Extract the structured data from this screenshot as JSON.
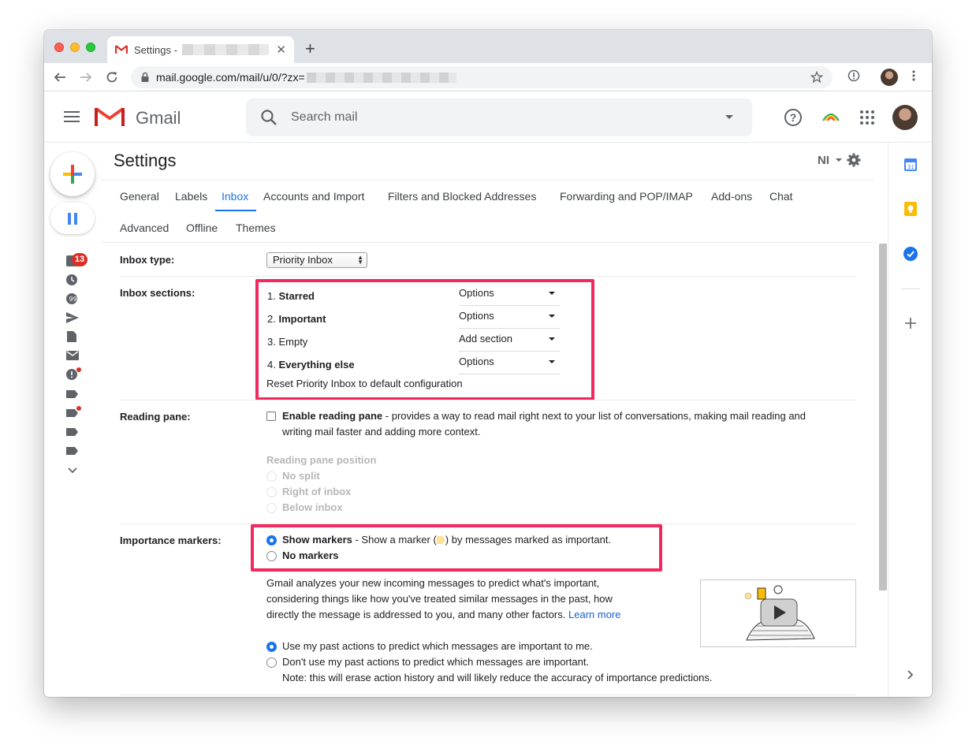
{
  "browser": {
    "tab_title": "Settings -",
    "tab_close": "✕",
    "new_tab": "+",
    "url": "mail.google.com/mail/u/0/?zx="
  },
  "header": {
    "app_name": "Gmail",
    "search_placeholder": "Search mail",
    "account_initials": "NI"
  },
  "left_rail": {
    "inbox_badge": "13"
  },
  "settings": {
    "title": "Settings",
    "tabs": [
      "General",
      "Labels",
      "Inbox",
      "Accounts and Import",
      "Filters and Blocked Addresses",
      "Forwarding and POP/IMAP",
      "Add-ons",
      "Chat",
      "Advanced",
      "Offline",
      "Themes"
    ],
    "active_tab": "Inbox",
    "inbox_type": {
      "label": "Inbox type:",
      "value": "Priority Inbox"
    },
    "inbox_sections": {
      "label": "Inbox sections:",
      "sections": [
        {
          "num": "1.",
          "name": "Starred",
          "bold": true,
          "action": "Options"
        },
        {
          "num": "2.",
          "name": "Important",
          "bold": true,
          "action": "Options"
        },
        {
          "num": "3.",
          "name": "Empty",
          "bold": false,
          "action": "Add section"
        },
        {
          "num": "4.",
          "name": "Everything else",
          "bold": true,
          "action": "Options"
        }
      ],
      "reset_link": "Reset Priority Inbox to default configuration"
    },
    "reading_pane": {
      "label": "Reading pane:",
      "enable_label": "Enable reading pane",
      "enable_desc_line1": " - provides a way to read mail right next to your list of conversations, making mail reading and",
      "enable_desc_line2": "writing mail faster and adding more context.",
      "position_heading": "Reading pane position",
      "positions": [
        "No split",
        "Right of inbox",
        "Below inbox"
      ],
      "enabled": false
    },
    "importance_markers": {
      "label": "Importance markers:",
      "show_label": "Show markers",
      "show_desc_pre": " - Show a marker (",
      "show_desc_post": ") by messages marked as important.",
      "no_label": "No markers",
      "selected": "Show markers",
      "explain_line1": "Gmail analyzes your new incoming messages to predict what's important,",
      "explain_line2": "considering things like how you've treated similar messages in the past, how",
      "explain_line3": "directly the message is addressed to you, and many other factors.",
      "learn_more": "Learn more",
      "predict_on": "Use my past actions to predict which messages are important to me.",
      "predict_off": "Don't use my past actions to predict which messages are important.",
      "predict_note": "Note: this will erase action history and will likely reduce the accuracy of importance predictions."
    }
  },
  "colors": {
    "accent": "#1a73e8",
    "highlight": "#f2285e",
    "badge": "#d93025"
  }
}
